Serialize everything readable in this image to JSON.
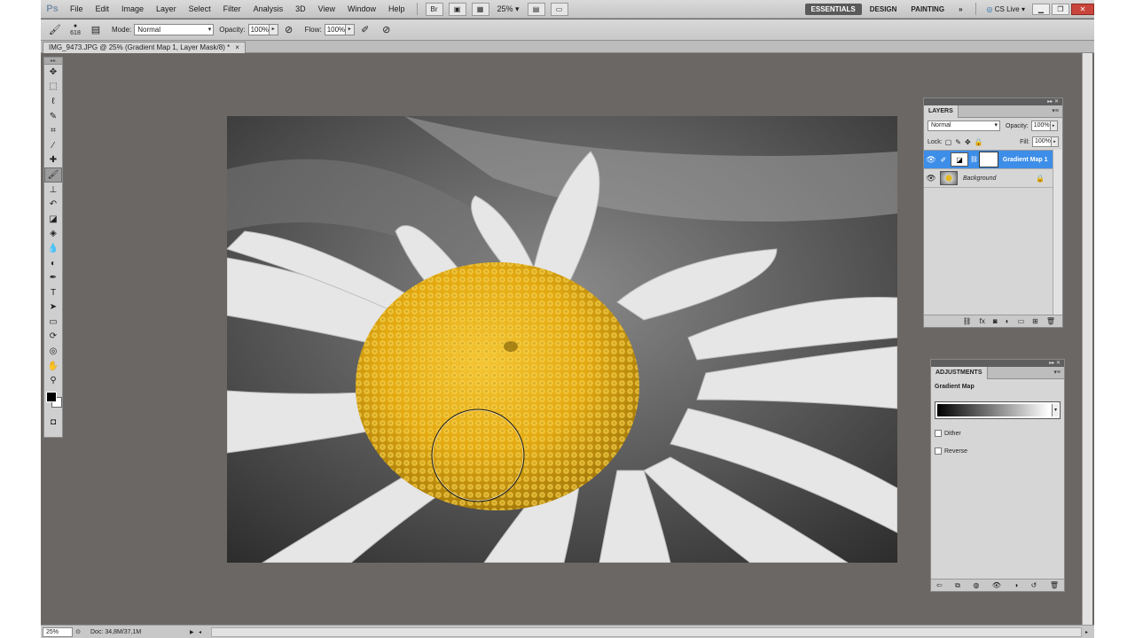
{
  "app": {
    "logo": "Ps"
  },
  "menu": [
    "File",
    "Edit",
    "Image",
    "Layer",
    "Select",
    "Filter",
    "Analysis",
    "3D",
    "View",
    "Window",
    "Help"
  ],
  "zoom_level": "25%",
  "workspaces": [
    "ESSENTIALS",
    "DESIGN",
    "PAINTING"
  ],
  "workspace_more": "»",
  "cslive": "CS Live",
  "options": {
    "brush_size": "618",
    "mode_label": "Mode:",
    "mode_value": "Normal",
    "opacity_label": "Opacity:",
    "opacity_value": "100%",
    "flow_label": "Flow:",
    "flow_value": "100%"
  },
  "document_tab": {
    "title": "IMG_9473.JPG @ 25% (Gradient Map 1, Layer Mask/8) *",
    "close": "×"
  },
  "layers_panel": {
    "tab": "LAYERS",
    "blend_mode": "Normal",
    "opacity_label": "Opacity:",
    "opacity_value": "100%",
    "lock_label": "Lock:",
    "fill_label": "Fill:",
    "fill_value": "100%",
    "layers": [
      {
        "name": "Gradient Map 1"
      },
      {
        "name": "Background"
      }
    ]
  },
  "adjustments_panel": {
    "tab": "ADJUSTMENTS",
    "title": "Gradient Map",
    "dither_label": "Dither",
    "reverse_label": "Reverse"
  },
  "status": {
    "zoom": "25%",
    "doc": "Doc: 34,8M/37,1M"
  },
  "colors": {
    "workspace_bg": "#6b6764",
    "layer_selected": "#3d8ee8",
    "flower_center": "#e2b822",
    "foreground": "#000000",
    "background": "#ffffff"
  },
  "icons": {
    "tools": [
      "move-icon",
      "marquee-icon",
      "lasso-icon",
      "quick-select-icon",
      "crop-icon",
      "eyedropper-icon",
      "healing-brush-icon",
      "brush-icon",
      "clone-stamp-icon",
      "history-brush-icon",
      "eraser-icon",
      "paint-bucket-icon",
      "blur-icon",
      "dodge-icon",
      "pen-icon",
      "type-icon",
      "path-select-icon",
      "shape-icon",
      "3d-rotate-icon",
      "3d-orbit-icon",
      "hand-icon",
      "zoom-icon"
    ]
  }
}
